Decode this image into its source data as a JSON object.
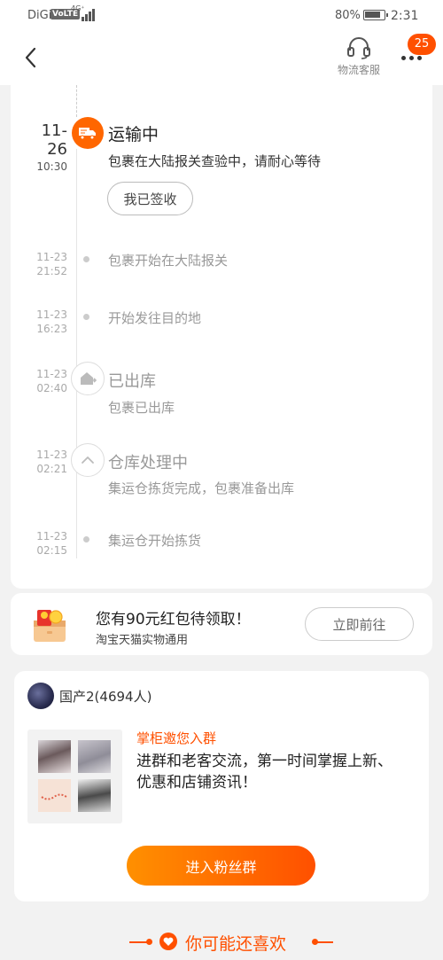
{
  "status_bar": {
    "carrier": "DiGi",
    "volte": "VoLTE",
    "network": "4G⁺",
    "battery": "80%",
    "time": "2:31"
  },
  "header": {
    "back_icon": "chevron-left-icon",
    "service_label": "物流客服",
    "service_icon": "headset-icon",
    "more_icon": "ellipsis-icon",
    "badge": "25"
  },
  "timeline": {
    "current": {
      "date": "11-26",
      "time": "10:30",
      "icon": "truck-icon",
      "title": "运输中",
      "text": "包裹在大陆报关查验中，请耐心等待",
      "button": "我已签收"
    },
    "events": [
      {
        "date": "11-23",
        "time": "21:52",
        "text": "包裹开始在大陆报关"
      },
      {
        "date": "11-23",
        "time": "16:23",
        "text": "开始发往目的地"
      },
      {
        "date": "11-23",
        "time": "02:40",
        "title": "已出库",
        "text": "包裹已出库",
        "icon": "warehouse-out-icon"
      },
      {
        "date": "11-23",
        "time": "02:21",
        "title": "仓库处理中",
        "text": "集运仓拣货完成，包裹准备出库",
        "icon": "chevron-up-icon"
      },
      {
        "date": "11-23",
        "time": "02:15",
        "text": "集运仓开始拣货"
      }
    ]
  },
  "red_packet": {
    "title": "您有90元红包待领取！",
    "subtitle": "淘宝天猫实物通用",
    "button": "立即前往"
  },
  "group": {
    "name": "国产2(4694人)",
    "invite": "掌柜邀您入群",
    "description": "进群和老客交流，第一时间掌握上新、优惠和店铺资讯！",
    "button": "进入粉丝群"
  },
  "recommend": {
    "title": "你可能还喜欢"
  },
  "colors": {
    "accent": "#ff5000",
    "accent_light": "#ff9000"
  }
}
